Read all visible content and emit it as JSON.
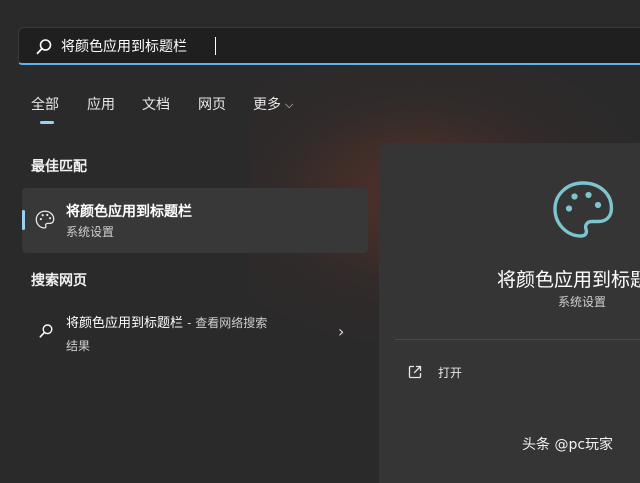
{
  "search": {
    "query": "将颜色应用到标题栏",
    "icon": "search-icon"
  },
  "tabs": [
    {
      "label": "全部",
      "active": true
    },
    {
      "label": "应用"
    },
    {
      "label": "文档"
    },
    {
      "label": "网页"
    },
    {
      "label": "更多"
    }
  ],
  "best_match": {
    "heading": "最佳匹配",
    "title": "将颜色应用到标题栏",
    "subtitle": "系统设置",
    "icon": "palette-icon"
  },
  "web_search": {
    "heading": "搜索网页",
    "query": "将颜色应用到标题栏",
    "suffix": "- 查看网络搜索",
    "suffix_line2": "结果",
    "icon": "search-icon"
  },
  "detail_panel": {
    "title": "将颜色应用到标题",
    "subtitle": "系统设置",
    "action_label": "打开",
    "icon": "palette-icon",
    "accent": "#7ec4cf"
  },
  "watermark": "头条 @pc玩家",
  "colors": {
    "accent": "#9ad0f5",
    "background": "#2a2a2a",
    "panel": "#353535"
  }
}
